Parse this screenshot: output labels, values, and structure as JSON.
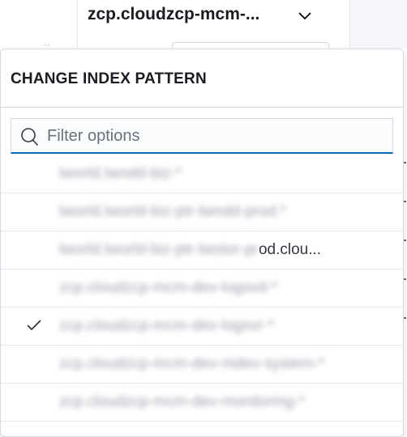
{
  "selector": {
    "title": "zcp.cloudzcp-mcm-..."
  },
  "popover": {
    "title": "CHANGE INDEX PATTERN",
    "search": {
      "placeholder": "Filter options",
      "value": ""
    },
    "options": [
      {
        "label": "tworld.twndd-biz-*",
        "checked": false,
        "blurred": true
      },
      {
        "label": "tworld.tworld-biz-ptr-twndd-prod.*",
        "checked": false,
        "blurred": true
      },
      {
        "blurred_part": "tworld.tworld-biz-ptr-twstor-pr",
        "visible_part": "od.clou...",
        "checked": false,
        "blurred": true
      },
      {
        "label": "zcp.cloudzcp-mcm-dev-logsvd-*",
        "checked": false,
        "blurred": true
      },
      {
        "label": "zcp.cloudzcp-mcm-dev-logsvr-*",
        "checked": true,
        "blurred": true
      },
      {
        "label": "zcp.cloudzcp-mcm-dev-mdev-system-*",
        "checked": false,
        "blurred": true
      },
      {
        "label": "zcp.cloudzcp-mcm-dev-monitoring-*",
        "checked": false,
        "blurred": true
      }
    ]
  },
  "colors": {
    "accent": "#006bb4",
    "border": "#d3dae6",
    "text": "#343741",
    "title": "#1a1c21"
  },
  "icons": {
    "chevron": "chevron-down-icon",
    "collapse": "arrow-left-icon",
    "search": "search-icon",
    "check": "check-icon"
  }
}
